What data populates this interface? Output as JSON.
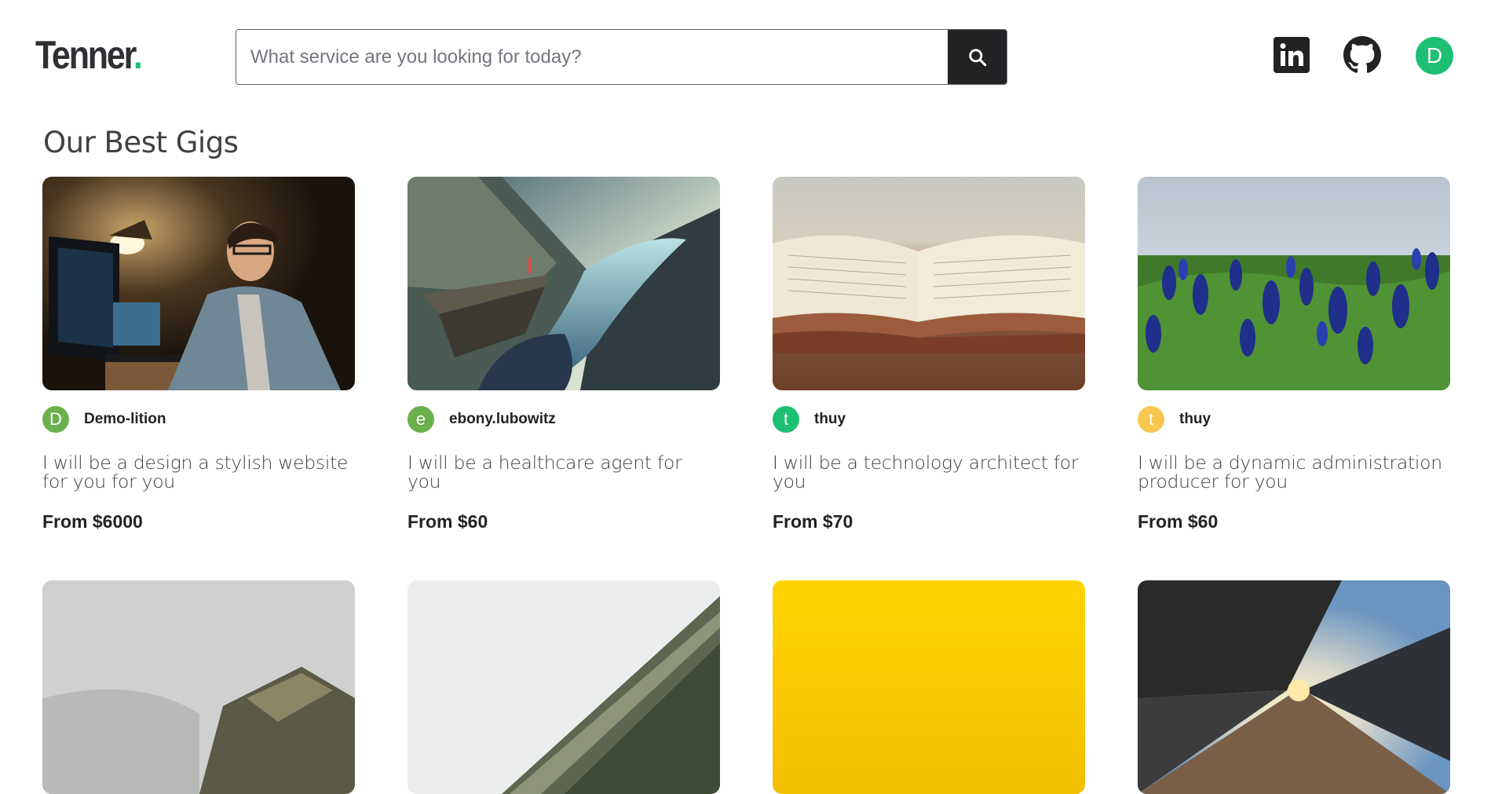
{
  "header": {
    "logo_text": "Tenner",
    "logo_dot": ".",
    "search_placeholder": "What service are you looking for today?",
    "icons": [
      "search-icon",
      "linkedin-icon",
      "github-icon"
    ],
    "user_initial": "D"
  },
  "colors": {
    "brand_green": "#1dbf73",
    "dark": "#222325",
    "text": "#404145"
  },
  "section": {
    "title": "Our Best Gigs"
  },
  "gigs": [
    {
      "seller": "Demo-lition",
      "initial": "D",
      "avatar_color": "#6ab04c",
      "title": "I will be a design a stylish website for you for you",
      "price": "From $6000"
    },
    {
      "seller": "ebony.lubowitz",
      "initial": "e",
      "avatar_color": "#6ab04c",
      "title": "I will be a healthcare agent for you",
      "price": "From $60"
    },
    {
      "seller": "thuy",
      "initial": "t",
      "avatar_color": "#1dbf73",
      "title": "I will be a technology architect for you",
      "price": "From $70"
    },
    {
      "seller": "thuy",
      "initial": "t",
      "avatar_color": "#f9c74f",
      "title": "I will be a dynamic administration producer for you",
      "price": "From $60"
    }
  ]
}
